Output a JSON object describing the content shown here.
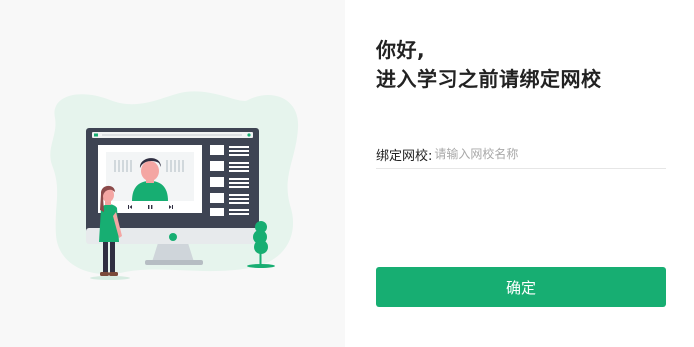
{
  "greeting": {
    "line1": "你好,",
    "line2": "进入学习之前请绑定网校"
  },
  "school_field": {
    "label": "绑定网校:",
    "placeholder": "请输入网校名称",
    "value": ""
  },
  "confirm": {
    "label": "确定"
  },
  "colors": {
    "accent": "#17ae72",
    "left_panel_bg": "#f8f8f8",
    "blob": "#e6f4ed"
  },
  "illustration": {
    "subject": "online-learning-illustration",
    "video_controls": [
      "previous-icon",
      "pause-icon",
      "next-icon"
    ]
  }
}
